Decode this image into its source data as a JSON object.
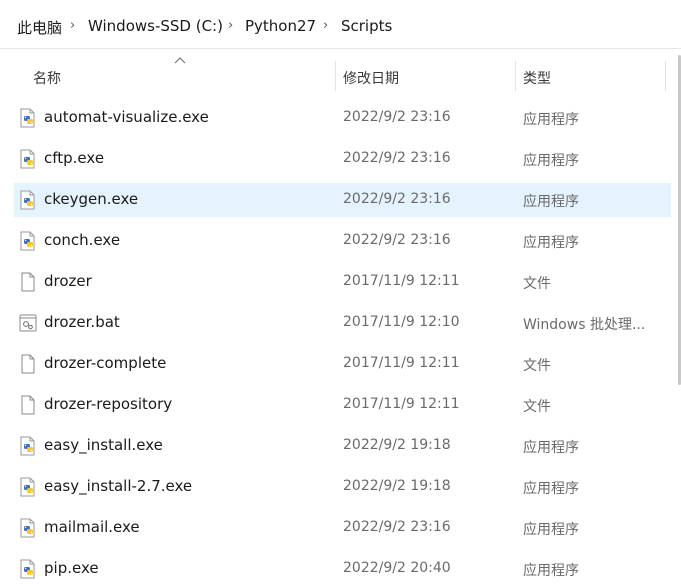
{
  "breadcrumb": [
    "此电脑",
    "Windows-SSD (C:)",
    "Python27",
    "Scripts"
  ],
  "columns": {
    "name": "名称",
    "date": "修改日期",
    "type": "类型"
  },
  "files": [
    {
      "name": "automat-visualize.exe",
      "date": "2022/9/2 23:16",
      "type": "应用程序",
      "icon": "python-exe-icon",
      "selected": false
    },
    {
      "name": "cftp.exe",
      "date": "2022/9/2 23:16",
      "type": "应用程序",
      "icon": "python-exe-icon",
      "selected": false
    },
    {
      "name": "ckeygen.exe",
      "date": "2022/9/2 23:16",
      "type": "应用程序",
      "icon": "python-exe-icon",
      "selected": true
    },
    {
      "name": "conch.exe",
      "date": "2022/9/2 23:16",
      "type": "应用程序",
      "icon": "python-exe-icon",
      "selected": false
    },
    {
      "name": "drozer",
      "date": "2017/11/9 12:11",
      "type": "文件",
      "icon": "file-icon",
      "selected": false
    },
    {
      "name": "drozer.bat",
      "date": "2017/11/9 12:10",
      "type": "Windows 批处理...",
      "icon": "batch-file-icon",
      "selected": false
    },
    {
      "name": "drozer-complete",
      "date": "2017/11/9 12:11",
      "type": "文件",
      "icon": "file-icon",
      "selected": false
    },
    {
      "name": "drozer-repository",
      "date": "2017/11/9 12:11",
      "type": "文件",
      "icon": "file-icon",
      "selected": false
    },
    {
      "name": "easy_install.exe",
      "date": "2022/9/2 19:18",
      "type": "应用程序",
      "icon": "python-exe-icon",
      "selected": false
    },
    {
      "name": "easy_install-2.7.exe",
      "date": "2022/9/2 19:18",
      "type": "应用程序",
      "icon": "python-exe-icon",
      "selected": false
    },
    {
      "name": "mailmail.exe",
      "date": "2022/9/2 23:16",
      "type": "应用程序",
      "icon": "python-exe-icon",
      "selected": false
    },
    {
      "name": "pip.exe",
      "date": "2022/9/2 20:40",
      "type": "应用程序",
      "icon": "python-exe-icon",
      "selected": false
    }
  ],
  "colors": {
    "selection": "#e5f3ff",
    "python_blue": "#3b73b4",
    "python_yellow": "#f6c83a"
  }
}
